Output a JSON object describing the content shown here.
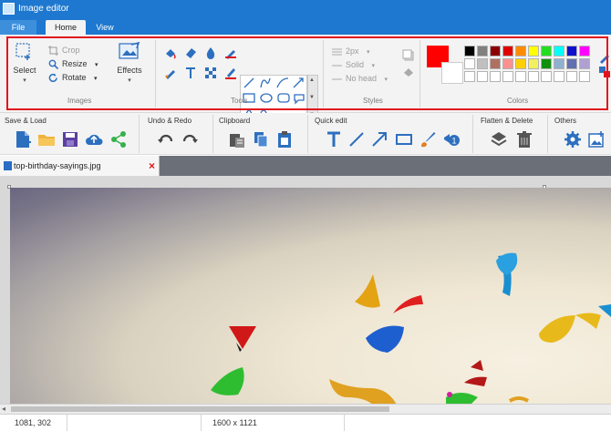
{
  "window": {
    "title": "Image editor"
  },
  "ribbon_tabs": {
    "file": "File",
    "home": "Home",
    "view": "View"
  },
  "ribbon": {
    "images": {
      "label": "Images",
      "select": "Select",
      "crop": "Crop",
      "resize": "Resize",
      "rotate": "Rotate",
      "effects": "Effects"
    },
    "tools": {
      "label": "Tools"
    },
    "styles": {
      "label": "Styles",
      "size": "2px",
      "line": "Solid",
      "head": "No head"
    },
    "colors": {
      "label": "Colors",
      "primary": "#ff0000",
      "secondary": "#ffffff",
      "palette_row1": [
        "#000000",
        "#808080",
        "#8b0000",
        "#e00000",
        "#ff8c00",
        "#ffff00",
        "#22dd22",
        "#00ffff",
        "#1010cc",
        "#ff00ff"
      ],
      "palette_row2": [
        "#ffffff",
        "#c0c0c0",
        "#b07060",
        "#ff9090",
        "#ffd000",
        "#f0f060",
        "#109010",
        "#8fb0d0",
        "#6070b0",
        "#b0a0d0"
      ],
      "palette_row3": [
        "#ffffff",
        "#ffffff",
        "#ffffff",
        "#ffffff",
        "#ffffff",
        "#ffffff",
        "#ffffff",
        "#ffffff",
        "#ffffff",
        "#ffffff"
      ]
    }
  },
  "command_groups": {
    "save_load": "Save & Load",
    "undo_redo": "Undo & Redo",
    "clipboard": "Clipboard",
    "quick_edit": "Quick edit",
    "flatten_delete": "Flatten & Delete",
    "others": "Others"
  },
  "document": {
    "tab_title": "top-birthday-sayings.jpg"
  },
  "status": {
    "cursor": "1081, 302",
    "dimensions": "1600 x 1121"
  },
  "icons": {
    "new": "new-file-icon",
    "open": "folder-icon",
    "save": "save-icon",
    "upload": "cloud-upload-icon",
    "share": "share-icon",
    "undo": "undo-icon",
    "redo": "redo-icon",
    "paste": "paste-icon",
    "copy": "copy-icon",
    "clipboard": "clipboard-icon",
    "text": "text-icon",
    "line": "line-icon",
    "arrow": "arrow-icon",
    "rect": "rectangle-icon",
    "brush": "brush-icon",
    "number": "number-icon",
    "flatten": "layers-icon",
    "delete": "trash-icon",
    "settings": "gear-icon",
    "image": "image-add-icon"
  }
}
